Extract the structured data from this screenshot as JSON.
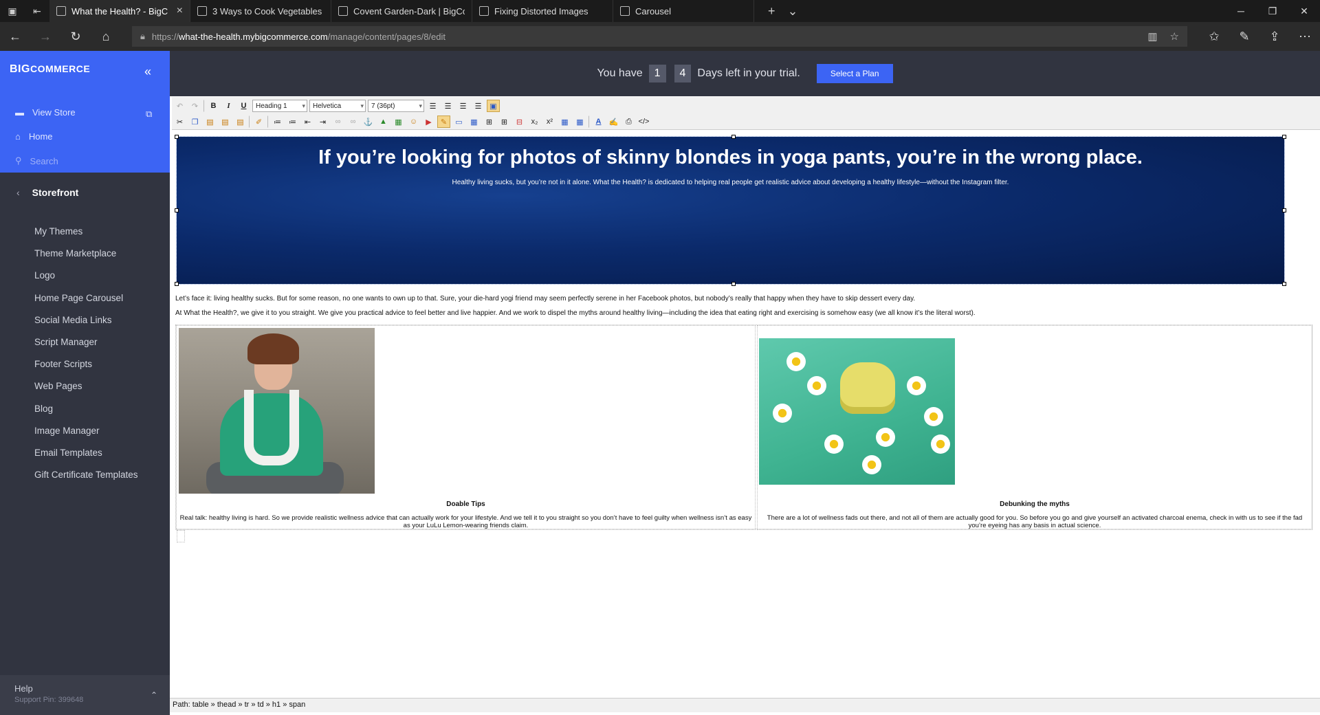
{
  "browser": {
    "tabs": [
      {
        "title": "What the Health? - BigC",
        "active": true
      },
      {
        "title": "3 Ways to Cook Vegetables",
        "active": false
      },
      {
        "title": "Covent Garden-Dark | BigCo",
        "active": false
      },
      {
        "title": "Fixing Distorted Images",
        "active": false
      },
      {
        "title": "Carousel",
        "active": false
      }
    ],
    "url_prefix": "https://",
    "url_host": "what-the-health.mybigcommerce.com",
    "url_path": "/manage/content/pages/8/edit"
  },
  "sidebar": {
    "logo_big": "BIG",
    "logo_rest": "COMMERCE",
    "view_store": "View Store",
    "home": "Home",
    "search_placeholder": "Search",
    "section": "Storefront",
    "items": [
      "My Themes",
      "Theme Marketplace",
      "Logo",
      "Home Page Carousel",
      "Social Media Links",
      "Script Manager",
      "Footer Scripts",
      "Web Pages",
      "Blog",
      "Image Manager",
      "Email Templates",
      "Gift Certificate Templates"
    ],
    "help_title": "Help",
    "help_pin": "Support Pin: 399648"
  },
  "trial": {
    "prefix": "You have",
    "digit1": "1",
    "digit2": "4",
    "suffix": "Days left in your trial.",
    "button": "Select a Plan"
  },
  "toolbar": {
    "format": "Heading 1",
    "font": "Helvetica",
    "size": "7 (36pt)",
    "bold": "B",
    "italic": "I",
    "underline": "U"
  },
  "editor": {
    "hero_title": "If you’re looking for photos of skinny blondes in yoga pants, you’re in the wrong place.",
    "hero_subtitle": "Healthy living sucks, but you’re not in it alone. What the Health? is dedicated to helping real people get realistic advice about developing a healthy lifestyle—without the Instagram filter.",
    "para1": "Let’s face it: living healthy sucks. But for some reason, no one wants to own up to that. Sure, your die-hard yogi friend may seem perfectly serene in her Facebook photos, but nobody’s really that happy when they have to skip dessert every day.",
    "para2": "At What the Health?, we give it to you straight. We give you practical advice to feel better and live happier. And we work to dispel the myths around healthy living—including the idea that eating right and exercising is somehow easy (we all know it’s the literal worst).",
    "col1_title": "Doable Tips",
    "col1_text": "Real talk: healthy living is hard. So we provide realistic wellness advice that can actually work for your lifestyle. And we tell it to you straight so you don’t have to feel guilty when wellness isn’t as easy as your LuLu Lemon-wearing friends claim.",
    "col2_title": "Debunking the myths",
    "col2_text": "There are a lot of wellness fads out there, and not all of them are actually good for you. So before you go and give yourself an activated charcoal enema, check in with us to see if the fad you’re eyeing has any basis in actual science."
  },
  "pathbar": "Path: table » thead » tr » td » h1 » span"
}
